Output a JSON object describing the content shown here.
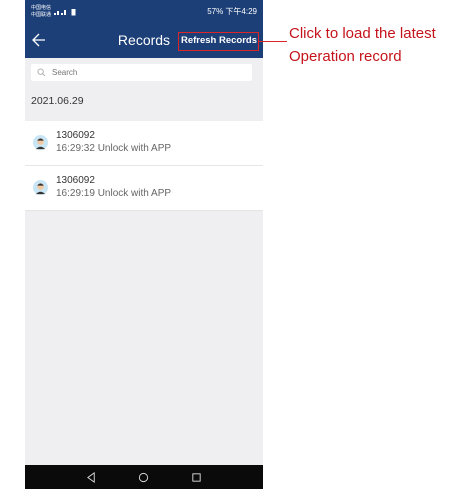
{
  "status_bar": {
    "carrier_line1": "中国电信",
    "carrier_line2": "中国联通",
    "right_text": "57% 下午4:29"
  },
  "header": {
    "title": "Records",
    "refresh_label": "Refresh Records"
  },
  "search": {
    "placeholder": "Search"
  },
  "date_header": "2021.06.29",
  "records": [
    {
      "user": "1306092",
      "detail": "16:29:32 Unlock with APP"
    },
    {
      "user": "1306092",
      "detail": "16:29:19 Unlock with APP"
    }
  ],
  "annotation": {
    "line1": "Click to load the latest",
    "line2": "Operation record"
  },
  "colors": {
    "header_bg": "#1c3f78",
    "annotation_red": "#c5131b",
    "list_bg": "#efeff1"
  }
}
